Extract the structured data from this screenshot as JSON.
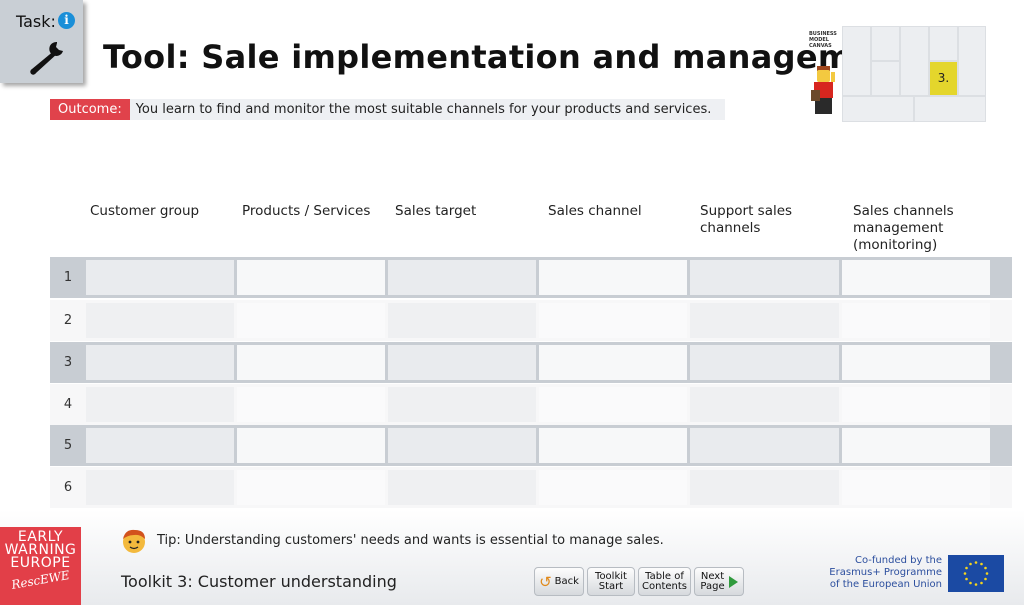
{
  "task": {
    "label": "Task:",
    "info_glyph": "i"
  },
  "title": "Tool: Sale implementation and management",
  "outcome": {
    "tag": "Outcome:",
    "text": "You learn to find and monitor the most suitable channels for your products and services."
  },
  "canvas_thumbnail": {
    "label_lines": [
      "BUSINESS",
      "MODEL",
      "CANVAS"
    ],
    "active_block": "3."
  },
  "table": {
    "columns": [
      "Customer group",
      "Products / Services",
      "Sales target",
      "Sales channel",
      "Support sales channels",
      "Sales channels management (monitoring)"
    ],
    "rows": [
      "1",
      "2",
      "3",
      "4",
      "5",
      "6"
    ]
  },
  "footer": {
    "brand_lines": [
      "EARLY",
      "WARNING",
      "EUROPE"
    ],
    "brand_signature": "RescEWE",
    "tip": "Tip: Understanding customers' needs and wants is essential to manage sales.",
    "toolkit_title": "Toolkit 3: Customer understanding",
    "nav": {
      "back": "Back",
      "toolkit_start": [
        "Toolkit",
        "Start"
      ],
      "table_of_contents": [
        "Table of",
        "Contents"
      ],
      "next_page": [
        "Next",
        "Page"
      ]
    },
    "cofunded_lines": [
      "Co-funded by the",
      "Erasmus+ Programme",
      "of the European Union"
    ]
  },
  "colors": {
    "accent_red": "#e0424b",
    "info_blue": "#1a8fd8",
    "canvas_highlight": "#e4d62c",
    "eu_blue": "#1b4aa3",
    "next_green": "#2f9a3c",
    "back_orange": "#e08a1c"
  }
}
